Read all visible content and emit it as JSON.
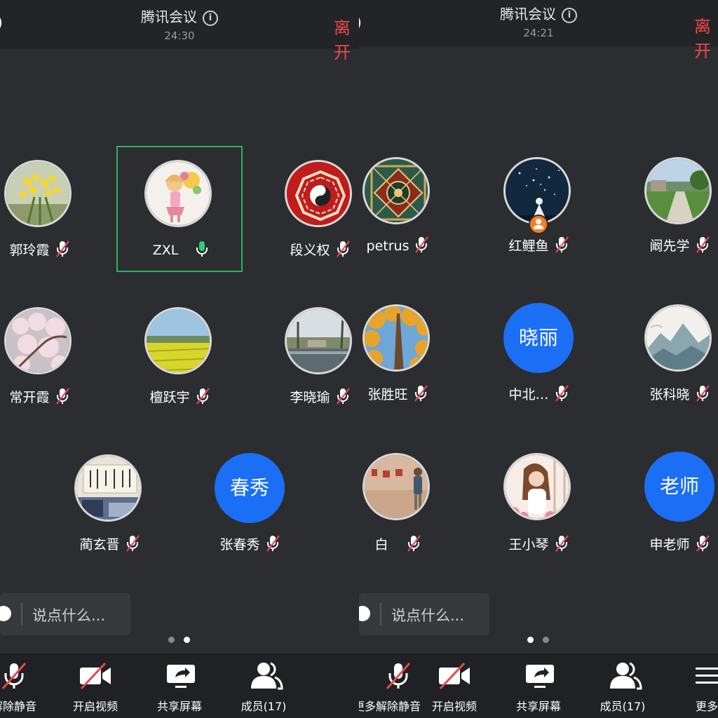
{
  "app_title": "腾讯会议",
  "leave_label": "离开",
  "chat_placeholder": "说点什么...",
  "left": {
    "timer": "24:30",
    "participants": [
      {
        "name": "郭玲霞",
        "avatar": "photo-yellow-flowers",
        "mic": "muted"
      },
      {
        "name": "ZXL",
        "avatar": "photo-cartoon-girl",
        "mic": "on",
        "active": true
      },
      {
        "name": "段义权",
        "avatar": "photo-bagua",
        "mic": "muted"
      },
      {
        "name": "常开霞",
        "avatar": "photo-blossoms",
        "mic": "muted"
      },
      {
        "name": "檀跃宇",
        "avatar": "photo-canola-field",
        "mic": "muted"
      },
      {
        "name": "李晓瑜",
        "avatar": "photo-lake",
        "mic": "muted"
      },
      {
        "name": "蔺玄晋",
        "avatar": "photo-calligraphy-room",
        "mic": "muted"
      },
      {
        "name": "张春秀",
        "avatar_text": "春秀",
        "mic": "muted"
      }
    ],
    "page_dots": [
      false,
      true
    ],
    "toolbar": [
      "解除静音",
      "开启视频",
      "共享屏幕",
      "成员(17)"
    ]
  },
  "right": {
    "timer": "24:21",
    "participants": [
      {
        "name": "petrus",
        "avatar": "photo-mandala",
        "mic": "muted"
      },
      {
        "name": "红鲤鱼",
        "avatar": "photo-night-sky-girl",
        "mic": "muted",
        "host": true
      },
      {
        "name": "阚先学",
        "avatar": "photo-garden-path",
        "mic": "muted"
      },
      {
        "name": "张胜旺",
        "avatar": "photo-autumn-trees",
        "mic": "muted"
      },
      {
        "name": "中北…",
        "avatar_text": "晓丽",
        "mic": "muted"
      },
      {
        "name": "张科晓",
        "avatar": "photo-ink-mountains",
        "mic": "muted"
      },
      {
        "name": "白",
        "avatar": "photo-man-at-wall",
        "mic": "muted"
      },
      {
        "name": "王小琴",
        "avatar": "photo-woman-portrait",
        "mic": "muted"
      },
      {
        "name": "申老师",
        "avatar_text": "老师",
        "mic": "muted"
      }
    ],
    "page_dots": [
      true,
      false
    ],
    "toolbar": [
      "更多",
      "解除静音",
      "开启视频",
      "共享屏幕",
      "成员(17)",
      "更多"
    ]
  },
  "colors": {
    "background": "#2c2d31",
    "toolbar": "#202124",
    "leave": "#f0484b",
    "accent_blue": "#1a6ff5",
    "active_border": "#29b35e",
    "mic_on": "#29d070",
    "mic_muted_slash": "#e5484d"
  }
}
